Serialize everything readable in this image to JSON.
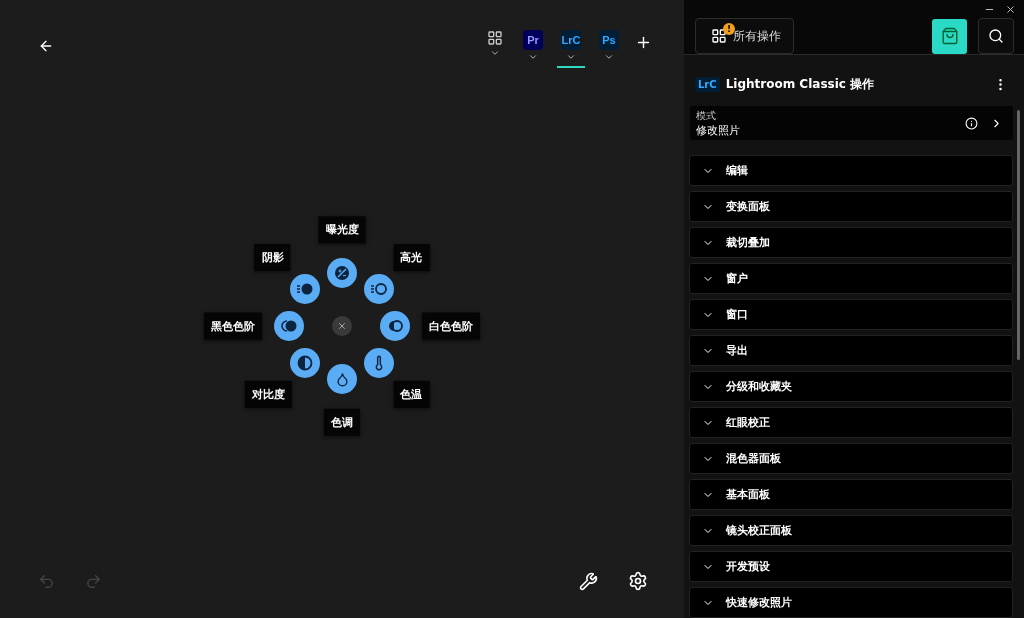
{
  "app_tabs": [
    {
      "kind": "all",
      "selected": false
    },
    {
      "kind": "app",
      "label": "Pr",
      "color": "#9999ff",
      "selected": false
    },
    {
      "kind": "app",
      "label": "LrC",
      "color": "#31a8ff",
      "selected": true
    },
    {
      "kind": "app",
      "label": "Ps",
      "color": "#31a8ff",
      "selected": false
    }
  ],
  "radial_menu": [
    {
      "label": "曝光度"
    },
    {
      "label": "高光"
    },
    {
      "label": "白色色阶"
    },
    {
      "label": "色温"
    },
    {
      "label": "色调"
    },
    {
      "label": "对比度"
    },
    {
      "label": "黑色色阶"
    },
    {
      "label": "阴影"
    }
  ],
  "bottom_bar": {
    "undo_disabled": true,
    "redo_disabled": true
  },
  "sidebar": {
    "all_actions": "所有操作",
    "all_actions_alert": "!",
    "app_badge": "LrC",
    "title": "Lightroom Classic 操作",
    "mode": {
      "caption": "模式",
      "value": "修改照片"
    },
    "sections": [
      {
        "label": "编辑",
        "expanded": false
      },
      {
        "label": "变换面板",
        "expanded": false
      },
      {
        "label": "裁切叠加",
        "expanded": false
      },
      {
        "label": "窗户",
        "expanded": false
      },
      {
        "label": "窗口",
        "expanded": false
      },
      {
        "label": "导出",
        "expanded": false
      },
      {
        "label": "分级和收藏夹",
        "expanded": false
      },
      {
        "label": "红眼校正",
        "expanded": false
      },
      {
        "label": "混色器面板",
        "expanded": false
      },
      {
        "label": "基本面板",
        "expanded": false
      },
      {
        "label": "镜头校正面板",
        "expanded": false
      },
      {
        "label": "开发预设",
        "expanded": false
      },
      {
        "label": "快速修改照片",
        "expanded": false
      }
    ]
  }
}
